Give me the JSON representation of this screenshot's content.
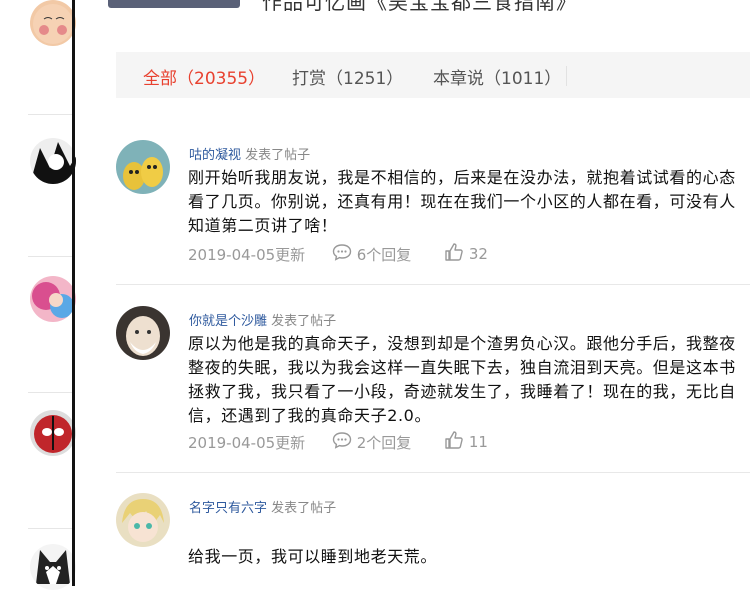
{
  "top": {
    "title": "作品可忆画《吴宝宝都三食指南》"
  },
  "tabs": [
    {
      "label": "全部（20355）",
      "active": true
    },
    {
      "label": "打赏（1251）",
      "active": false
    },
    {
      "label": "本章说（1011）",
      "active": false
    }
  ],
  "comments": [
    {
      "user": "咕的凝视",
      "action": "发表了帖子",
      "body": "刚开始听我朋友说，我是不相信的，后来是在没办法，就抱着试试看的心态看了几页。你别说，还真有用！现在在我们一个小区的人都在看，可没有人知道第二页讲了啥！",
      "date": "2019-04-05更新",
      "replies": "6个回复",
      "likes": "32"
    },
    {
      "user": "你就是个沙雕",
      "action": "发表了帖子",
      "body": "原以为他是我的真命天子，没想到却是个渣男负心汉。跟他分手后，我整夜整夜的失眠，我以为我会这样一直失眠下去，独自流泪到天亮。但是这本书拯救了我，我只看了一小段，奇迹就发生了，我睡着了！现在的我，无比自信，还遇到了我的真命天子2.0。",
      "date": "2019-04-05更新",
      "replies": "2个回复",
      "likes": "11"
    },
    {
      "user": "名字只有六字",
      "action": "发表了帖子",
      "body": "给我一页，我可以睡到地老天荒。"
    }
  ],
  "icons": {
    "reply": "comment-bubble-icon",
    "like": "thumbs-up-icon"
  },
  "colors": {
    "accent": "#e8412f",
    "username": "#2f5a9e",
    "meta": "#999999"
  }
}
